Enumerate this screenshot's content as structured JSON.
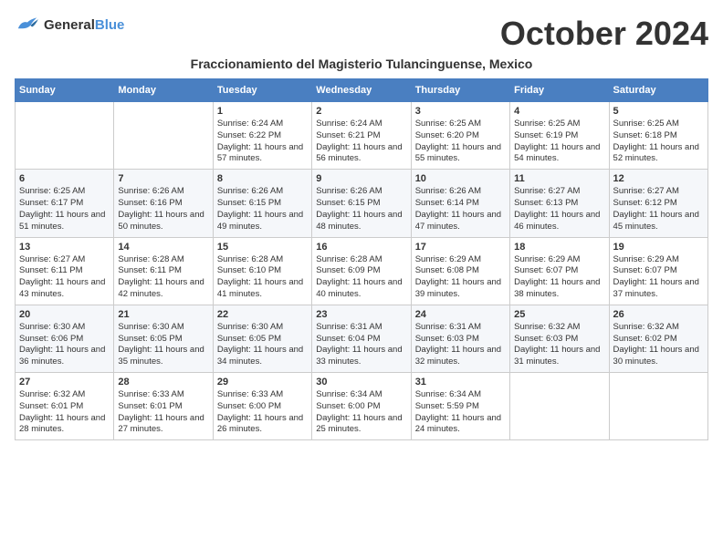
{
  "logo": {
    "line1": "General",
    "line2": "Blue"
  },
  "title": "October 2024",
  "subtitle": "Fraccionamiento del Magisterio Tulancinguense, Mexico",
  "weekdays": [
    "Sunday",
    "Monday",
    "Tuesday",
    "Wednesday",
    "Thursday",
    "Friday",
    "Saturday"
  ],
  "weeks": [
    [
      {
        "day": "",
        "info": ""
      },
      {
        "day": "",
        "info": ""
      },
      {
        "day": "1",
        "info": "Sunrise: 6:24 AM\nSunset: 6:22 PM\nDaylight: 11 hours and 57 minutes."
      },
      {
        "day": "2",
        "info": "Sunrise: 6:24 AM\nSunset: 6:21 PM\nDaylight: 11 hours and 56 minutes."
      },
      {
        "day": "3",
        "info": "Sunrise: 6:25 AM\nSunset: 6:20 PM\nDaylight: 11 hours and 55 minutes."
      },
      {
        "day": "4",
        "info": "Sunrise: 6:25 AM\nSunset: 6:19 PM\nDaylight: 11 hours and 54 minutes."
      },
      {
        "day": "5",
        "info": "Sunrise: 6:25 AM\nSunset: 6:18 PM\nDaylight: 11 hours and 52 minutes."
      }
    ],
    [
      {
        "day": "6",
        "info": "Sunrise: 6:25 AM\nSunset: 6:17 PM\nDaylight: 11 hours and 51 minutes."
      },
      {
        "day": "7",
        "info": "Sunrise: 6:26 AM\nSunset: 6:16 PM\nDaylight: 11 hours and 50 minutes."
      },
      {
        "day": "8",
        "info": "Sunrise: 6:26 AM\nSunset: 6:15 PM\nDaylight: 11 hours and 49 minutes."
      },
      {
        "day": "9",
        "info": "Sunrise: 6:26 AM\nSunset: 6:15 PM\nDaylight: 11 hours and 48 minutes."
      },
      {
        "day": "10",
        "info": "Sunrise: 6:26 AM\nSunset: 6:14 PM\nDaylight: 11 hours and 47 minutes."
      },
      {
        "day": "11",
        "info": "Sunrise: 6:27 AM\nSunset: 6:13 PM\nDaylight: 11 hours and 46 minutes."
      },
      {
        "day": "12",
        "info": "Sunrise: 6:27 AM\nSunset: 6:12 PM\nDaylight: 11 hours and 45 minutes."
      }
    ],
    [
      {
        "day": "13",
        "info": "Sunrise: 6:27 AM\nSunset: 6:11 PM\nDaylight: 11 hours and 43 minutes."
      },
      {
        "day": "14",
        "info": "Sunrise: 6:28 AM\nSunset: 6:11 PM\nDaylight: 11 hours and 42 minutes."
      },
      {
        "day": "15",
        "info": "Sunrise: 6:28 AM\nSunset: 6:10 PM\nDaylight: 11 hours and 41 minutes."
      },
      {
        "day": "16",
        "info": "Sunrise: 6:28 AM\nSunset: 6:09 PM\nDaylight: 11 hours and 40 minutes."
      },
      {
        "day": "17",
        "info": "Sunrise: 6:29 AM\nSunset: 6:08 PM\nDaylight: 11 hours and 39 minutes."
      },
      {
        "day": "18",
        "info": "Sunrise: 6:29 AM\nSunset: 6:07 PM\nDaylight: 11 hours and 38 minutes."
      },
      {
        "day": "19",
        "info": "Sunrise: 6:29 AM\nSunset: 6:07 PM\nDaylight: 11 hours and 37 minutes."
      }
    ],
    [
      {
        "day": "20",
        "info": "Sunrise: 6:30 AM\nSunset: 6:06 PM\nDaylight: 11 hours and 36 minutes."
      },
      {
        "day": "21",
        "info": "Sunrise: 6:30 AM\nSunset: 6:05 PM\nDaylight: 11 hours and 35 minutes."
      },
      {
        "day": "22",
        "info": "Sunrise: 6:30 AM\nSunset: 6:05 PM\nDaylight: 11 hours and 34 minutes."
      },
      {
        "day": "23",
        "info": "Sunrise: 6:31 AM\nSunset: 6:04 PM\nDaylight: 11 hours and 33 minutes."
      },
      {
        "day": "24",
        "info": "Sunrise: 6:31 AM\nSunset: 6:03 PM\nDaylight: 11 hours and 32 minutes."
      },
      {
        "day": "25",
        "info": "Sunrise: 6:32 AM\nSunset: 6:03 PM\nDaylight: 11 hours and 31 minutes."
      },
      {
        "day": "26",
        "info": "Sunrise: 6:32 AM\nSunset: 6:02 PM\nDaylight: 11 hours and 30 minutes."
      }
    ],
    [
      {
        "day": "27",
        "info": "Sunrise: 6:32 AM\nSunset: 6:01 PM\nDaylight: 11 hours and 28 minutes."
      },
      {
        "day": "28",
        "info": "Sunrise: 6:33 AM\nSunset: 6:01 PM\nDaylight: 11 hours and 27 minutes."
      },
      {
        "day": "29",
        "info": "Sunrise: 6:33 AM\nSunset: 6:00 PM\nDaylight: 11 hours and 26 minutes."
      },
      {
        "day": "30",
        "info": "Sunrise: 6:34 AM\nSunset: 6:00 PM\nDaylight: 11 hours and 25 minutes."
      },
      {
        "day": "31",
        "info": "Sunrise: 6:34 AM\nSunset: 5:59 PM\nDaylight: 11 hours and 24 minutes."
      },
      {
        "day": "",
        "info": ""
      },
      {
        "day": "",
        "info": ""
      }
    ]
  ]
}
